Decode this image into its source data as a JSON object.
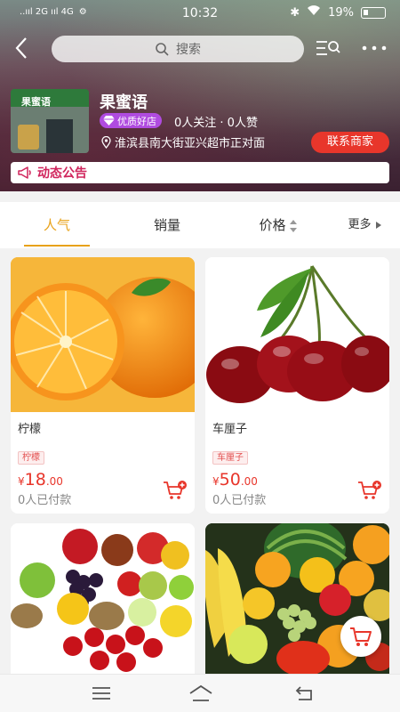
{
  "status_bar": {
    "carrier": "..ııl 2G ııl 4G",
    "time": "10:32",
    "battery": "19%"
  },
  "nav": {
    "search_placeholder": "搜索"
  },
  "shop": {
    "name": "果蜜语",
    "badge": "优质好店",
    "follow_stats": "0人关注 · 0人赞",
    "address": "淮滨县南大街亚兴超市正对面",
    "contact_button": "联系商家",
    "notice_label": "动态公告",
    "storefront_sign": "果蜜语"
  },
  "sort_tabs": [
    {
      "label": "人气",
      "active": true
    },
    {
      "label": "销量",
      "active": false
    },
    {
      "label": "价格",
      "active": false
    },
    {
      "label": "更多",
      "active": false
    }
  ],
  "products": [
    {
      "name": "柠檬",
      "tag": "柠檬",
      "currency": "¥",
      "price_int": "18",
      "price_dec": ".00",
      "paid": "0人已付款"
    },
    {
      "name": "车厘子",
      "tag": "车厘子",
      "currency": "¥",
      "price_int": "50",
      "price_dec": ".00",
      "paid": "0人已付款"
    }
  ],
  "colors": {
    "accent": "#e8a21a",
    "price": "#e8362b",
    "contact_button": "#e8362b",
    "badge": "#b04be0",
    "notice": "#d0245c"
  }
}
